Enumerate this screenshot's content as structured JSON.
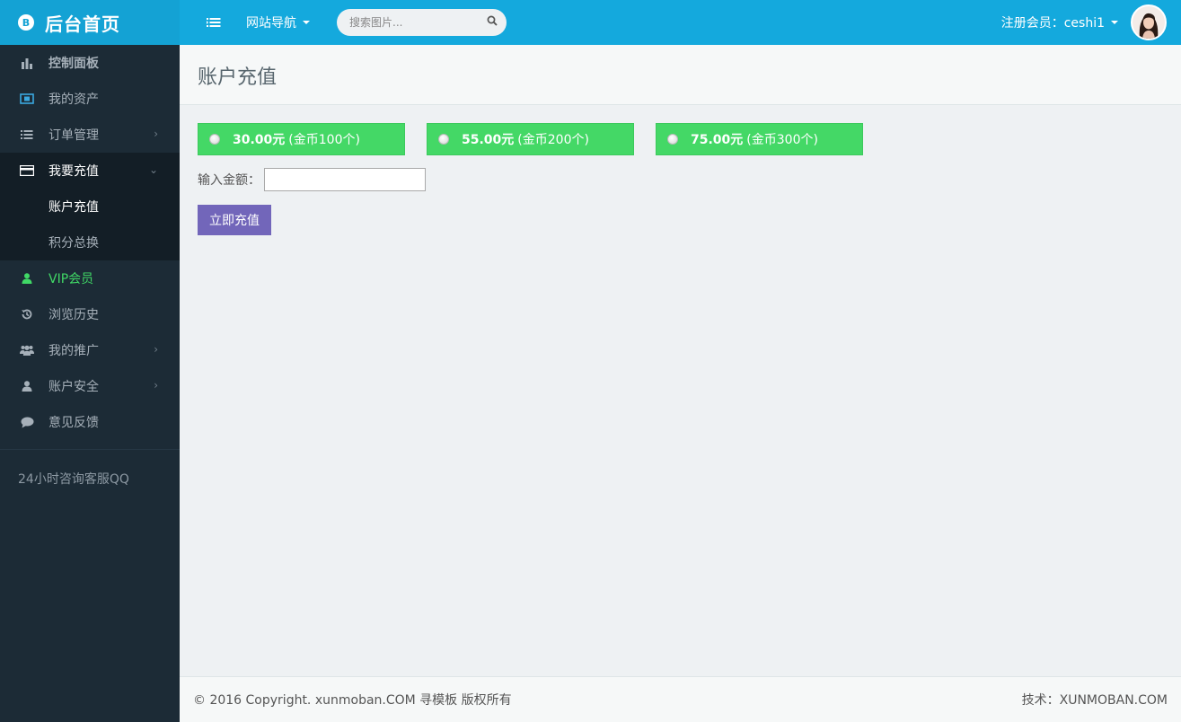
{
  "brand": {
    "logo_glyph": "B",
    "title": "后台首页"
  },
  "sidebar": {
    "items": [
      {
        "label": "控制面板",
        "icon": "bar-chart-icon"
      },
      {
        "label": "我的资产",
        "icon": "wallet-icon"
      },
      {
        "label": "订单管理",
        "icon": "list-icon",
        "has_children": true
      },
      {
        "label": "我要充值",
        "icon": "credit-card-icon",
        "expanded": true,
        "children": [
          {
            "label": "账户充值",
            "current": true
          },
          {
            "label": "积分总换"
          }
        ]
      },
      {
        "label": "VIP会员",
        "icon": "user-icon",
        "color": "#40d866"
      },
      {
        "label": "浏览历史",
        "icon": "history-icon"
      },
      {
        "label": "我的推广",
        "icon": "users-icon",
        "has_children": true
      },
      {
        "label": "账户安全",
        "icon": "user-icon",
        "has_children": true
      },
      {
        "label": "意见反馈",
        "icon": "comment-icon"
      }
    ],
    "support": "24小时咨询客服QQ"
  },
  "header": {
    "site_nav": "网站导航",
    "search_placeholder": "搜索图片...",
    "user_label": "注册会员：ceshi1"
  },
  "page": {
    "title": "账户充值",
    "options": [
      {
        "price": "30.00元",
        "coins": "(金币100个)"
      },
      {
        "price": "55.00元",
        "coins": "(金币200个)"
      },
      {
        "price": "75.00元",
        "coins": "(金币300个)"
      }
    ],
    "amount_label": "输入金额：",
    "amount_value": "",
    "submit_label": "立即充值"
  },
  "footer": {
    "copyright": "© 2016 Copyright. xunmoban.COM 寻模板 版权所有",
    "tech": "技术：XUNMOBAN.COM"
  },
  "colors": {
    "brand": "#14a2d4",
    "topbar": "#14a9dd",
    "sidebar": "#1c2b36",
    "option_green": "#44d866",
    "button_purple": "#7266ba"
  }
}
